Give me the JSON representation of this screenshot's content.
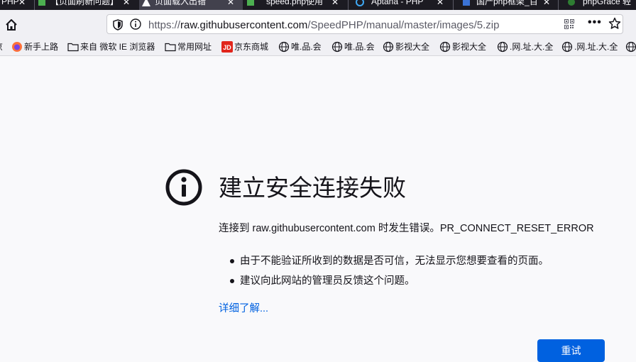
{
  "tabs": [
    {
      "label": "PHP"
    },
    {
      "label": "【页面刷新问题】"
    },
    {
      "label": "页面载入出错",
      "active": true
    },
    {
      "label": "speed.php使用"
    },
    {
      "label": "Aptana - PHP"
    },
    {
      "label": "国产php框架_百"
    },
    {
      "label": "phpGrace 轻"
    }
  ],
  "navbar": {
    "url_scheme": "https://",
    "url_host": "raw.githubusercontent.com",
    "url_path": "/SpeedPHP/manual/master/images/5.zip"
  },
  "bookmarks": [
    {
      "label": "新手上路",
      "icon": "firefox-icon"
    },
    {
      "label": "来自 微软 IE 浏览器",
      "icon": "folder-icon"
    },
    {
      "label": "常用网址",
      "icon": "folder-icon"
    },
    {
      "label": "京东商城",
      "icon": "jd-icon"
    },
    {
      "label": "唯.品.会",
      "icon": "globe-icon"
    },
    {
      "label": "唯.品.会",
      "icon": "globe-icon"
    },
    {
      "label": "影视大全",
      "icon": "globe-icon"
    },
    {
      "label": "影视大全",
      "icon": "globe-icon"
    },
    {
      "label": ".网.址.大.全",
      "icon": "globe-icon"
    },
    {
      "label": ".网.址.大.全",
      "icon": "globe-icon"
    }
  ],
  "error": {
    "title": "建立安全连接失败",
    "description": "连接到 raw.githubusercontent.com 时发生错误。PR_CONNECT_RESET_ERROR",
    "bullets": [
      "由于不能验证所收到的数据是否可信，无法显示您想要查看的页面。",
      "建议向此网站的管理员反馈这个问题。"
    ],
    "learn_more": "详细了解...",
    "try_again": "重试"
  },
  "colors": {
    "tab_strip": "#1c1b22",
    "toolbar": "#f0f0f4",
    "page_bg": "#f9f9fb",
    "link": "#0061e0",
    "primary_button": "#0061e0"
  }
}
